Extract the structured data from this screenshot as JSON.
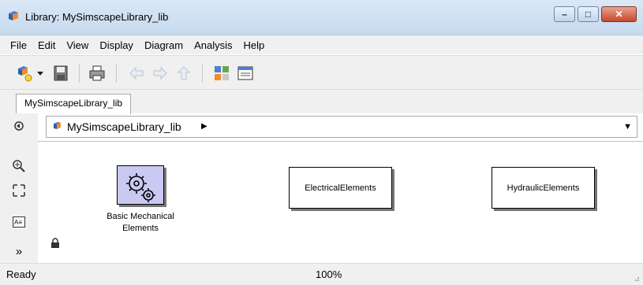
{
  "window": {
    "title": "Library: MySimscapeLibrary_lib"
  },
  "menu": [
    "File",
    "Edit",
    "View",
    "Display",
    "Diagram",
    "Analysis",
    "Help"
  ],
  "tab": {
    "label": "MySimscapeLibrary_lib"
  },
  "address": {
    "path": "MySimscapeLibrary_lib"
  },
  "blocks": {
    "mechanical": {
      "label_line1": "Basic Mechanical",
      "label_line2": "Elements"
    },
    "electrical": {
      "label": "ElectricalElements"
    },
    "hydraulic": {
      "label": "HydraulicElements"
    }
  },
  "status": {
    "left": "Ready",
    "zoom": "100%"
  },
  "icons": {
    "app": "simulink-library-icon",
    "new_model": "new-model-icon",
    "save": "save-icon",
    "print": "print-icon",
    "back": "back-arrow-icon",
    "forward": "forward-arrow-icon",
    "up": "up-arrow-icon",
    "library_browser": "library-browser-icon",
    "model_explorer": "model-explorer-icon"
  },
  "colors": {
    "mechanical_block_fill": "#c9c9f2",
    "close_button": "#c7482b"
  }
}
